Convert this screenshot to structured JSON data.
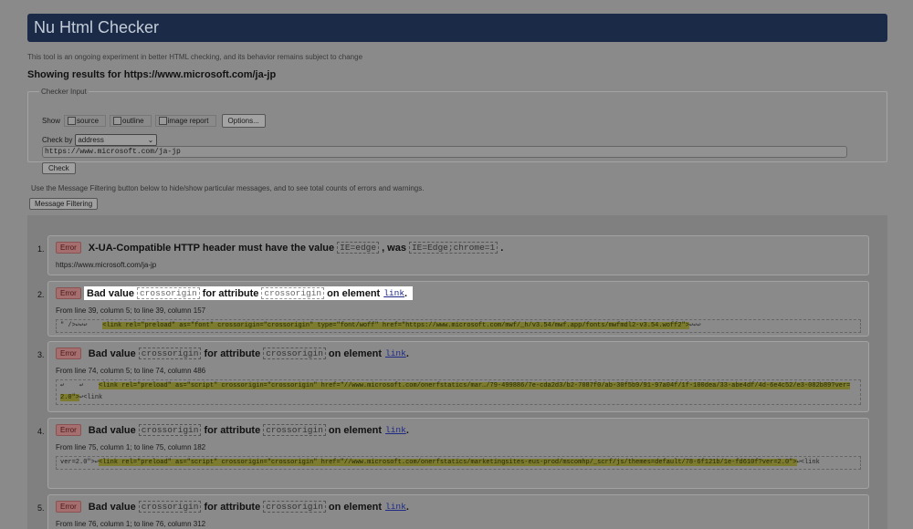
{
  "app": {
    "title": "Nu Html Checker"
  },
  "intro_note": "This tool is an ongoing experiment in better HTML checking, and its behavior remains subject to change",
  "showing": "Showing results for https://www.microsoft.com/ja-jp",
  "checker_input": {
    "legend": "Checker Input",
    "show_label": "Show",
    "checkboxes": [
      "source",
      "outline",
      "image report"
    ],
    "options_label": "Options...",
    "check_by_label": "Check by",
    "check_by_value": "address",
    "url_value": "https://www.microsoft.com/ja-jp",
    "check_label": "Check"
  },
  "filter_note": "Use the Message Filtering button below to hide/show particular messages, and to see total counts of errors and warnings.",
  "filter_button": "Message Filtering",
  "messages": [
    {
      "num": "1.",
      "badge": "Error",
      "parts": [
        "X-UA-Compatible HTTP header must have the value",
        "IE=edge",
        ", was",
        "IE=Edge;chrome=1",
        "."
      ],
      "location": "https://www.microsoft.com/ja-jp"
    },
    {
      "num": "2.",
      "badge": "Error",
      "parts": [
        "Bad value",
        "crossorigin",
        "for attribute",
        "crossorigin",
        "on element",
        "link",
        "."
      ],
      "location": "From line 39, column 5; to line 39, column 157",
      "extract_pre": "\" />↩↩↩    ",
      "extract_mark": "<link rel=\"preload\" as=\"font\" crossorigin=\"crossorigin\" type=\"font/woff\" href=\"https://www.microsoft.com/mwf/_h/v3.54/mwf.app/fonts/mwfmdl2-v3.54.woff2\">",
      "extract_post": "↩↩↩"
    },
    {
      "num": "3.",
      "badge": "Error",
      "parts": [
        "Bad value",
        "crossorigin",
        "for attribute",
        "crossorigin",
        "on element",
        "link",
        "."
      ],
      "location": "From line 74, column 5; to line 74, column 486",
      "extract_pre": "↩    ↩    ",
      "extract_mark": "<link rel=\"preload\" as=\"script\" crossorigin=\"crossorigin\" href=\"//www.microsoft.com/onerfstatics/mar…/79-499886/7e-cda2d3/b2-7087f0/ab-30f5b9/91-97a04f/1f-100dea/33-abe4df/4d-6e4c52/e3-082b89?ver=2.0\">",
      "extract_post": "↩<link"
    },
    {
      "num": "4.",
      "badge": "Error",
      "parts": [
        "Bad value",
        "crossorigin",
        "for attribute",
        "crossorigin",
        "on element",
        "link",
        "."
      ],
      "location": "From line 75, column 1; to line 75, column 182",
      "extract_pre": "ver=2.0\">↩",
      "extract_mark": "<link rel=\"preload\" as=\"script\" crossorigin=\"crossorigin\" href=\"//www.microsoft.com/onerfstatics/marketingsites-eus-prod/mscomhp/_scrf/js/themes=default/78-6f121b/1e-fd610f?ver=2.0\">",
      "extract_post": "↩<link"
    },
    {
      "num": "5.",
      "badge": "Error",
      "parts": [
        "Bad value",
        "crossorigin",
        "for attribute",
        "crossorigin",
        "on element",
        "link",
        "."
      ],
      "location": "From line 76, column 1; to line 76, column 312"
    }
  ],
  "colors": {
    "header_bg": "#1b2b47",
    "error_badge": "#a56f6f",
    "highlight": "#ffffff",
    "extract_mark": "#7d7b2d"
  }
}
